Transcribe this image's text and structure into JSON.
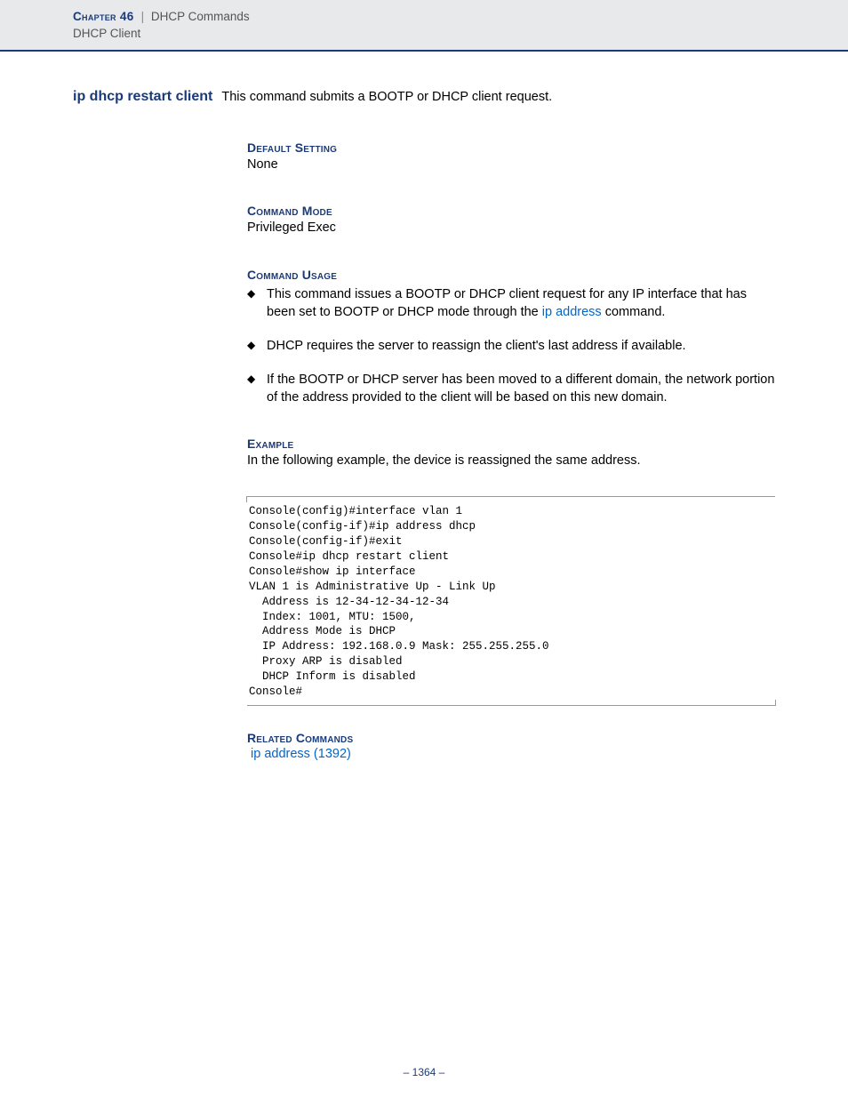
{
  "header": {
    "chapter_word": "Chapter",
    "chapter_num": "46",
    "divider": "|",
    "section": "DHCP Commands",
    "subsection": "DHCP Client"
  },
  "command": {
    "name": "ip dhcp restart client",
    "summary": "This command submits a BOOTP or DHCP client request."
  },
  "default_setting": {
    "heading": "Default Setting",
    "value": "None"
  },
  "command_mode": {
    "heading": "Command Mode",
    "value": "Privileged Exec"
  },
  "command_usage": {
    "heading": "Command Usage",
    "items": [
      {
        "pre": "This command issues a BOOTP or DHCP client request for any IP interface that has been set to BOOTP or DHCP mode through the ",
        "link": "ip address",
        "post": " command."
      },
      {
        "text": "DHCP requires the server to reassign the client's last address if available."
      },
      {
        "text": "If the BOOTP or DHCP server has been moved to a different domain, the network portion of the address provided to the client will be based on this new domain."
      }
    ]
  },
  "example": {
    "heading": "Example",
    "intro": "In the following example, the device is reassigned the same address.",
    "code": "Console(config)#interface vlan 1\nConsole(config-if)#ip address dhcp\nConsole(config-if)#exit\nConsole#ip dhcp restart client\nConsole#show ip interface\nVLAN 1 is Administrative Up - Link Up\n  Address is 12-34-12-34-12-34\n  Index: 1001, MTU: 1500,\n  Address Mode is DHCP\n  IP Address: 192.168.0.9 Mask: 255.255.255.0\n  Proxy ARP is disabled\n  DHCP Inform is disabled\nConsole#"
  },
  "related": {
    "heading": "Related Commands",
    "link": "ip address (1392)"
  },
  "page_number": "–  1364  –"
}
